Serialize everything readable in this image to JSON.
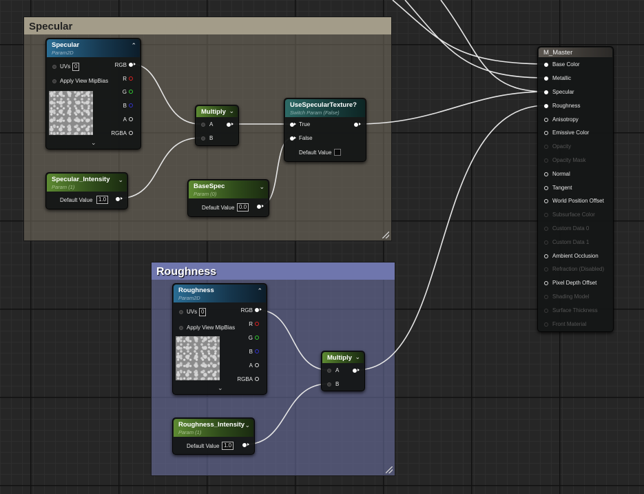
{
  "comments": {
    "specular": {
      "title": "Specular"
    },
    "roughness": {
      "title": "Roughness"
    }
  },
  "nodes": {
    "specular_tex": {
      "title": "Specular",
      "subtitle": "Param2D",
      "uvs_label": "UVs",
      "uvs_value": "0",
      "apply_mip": "Apply View MipBias",
      "outputs": [
        "RGB",
        "R",
        "G",
        "B",
        "A",
        "RGBA"
      ]
    },
    "multiply_spec": {
      "title": "Multiply",
      "in_a": "A",
      "in_b": "B"
    },
    "switch": {
      "title": "UseSpecularTexture?",
      "subtitle": "Switch Param (False)",
      "in_true": "True",
      "in_false": "False",
      "default_label": "Default Value"
    },
    "spec_intensity": {
      "title": "Specular_Intensity",
      "subtitle": "Param (1)",
      "default_label": "Default Value",
      "default_value": "1.0"
    },
    "basespec": {
      "title": "BaseSpec",
      "subtitle": "Param (0)",
      "default_label": "Default Value",
      "default_value": "0.0"
    },
    "roughness_tex": {
      "title": "Roughness",
      "subtitle": "Param2D",
      "uvs_label": "UVs",
      "uvs_value": "0",
      "apply_mip": "Apply View MipBias",
      "outputs": [
        "RGB",
        "R",
        "G",
        "B",
        "A",
        "RGBA"
      ]
    },
    "multiply_rough": {
      "title": "Multiply",
      "in_a": "A",
      "in_b": "B"
    },
    "rough_intensity": {
      "title": "Roughness_Intensity",
      "subtitle": "Param (1)",
      "default_label": "Default Value",
      "default_value": "1.0"
    },
    "master": {
      "title": "M_Master",
      "inputs": [
        "Base Color",
        "Metallic",
        "Specular",
        "Roughness",
        "Anisotropy",
        "Emissive Color",
        "Opacity",
        "Opacity Mask",
        "Normal",
        "Tangent",
        "World Position Offset",
        "Subsurface Color",
        "Custom Data 0",
        "Custom Data 1",
        "Ambient Occlusion",
        "Refraction (Disabled)",
        "Pixel Depth Offset",
        "Shading Model",
        "Surface Thickness",
        "Front Material"
      ]
    }
  },
  "colors": {
    "specular_comment": "#8a8272",
    "roughness_comment": "#7479a8",
    "param_blue": "#2a6d94",
    "param_green": "#5d8a32",
    "switch_teal": "#2d6a66",
    "master_header": "#5b5650"
  }
}
